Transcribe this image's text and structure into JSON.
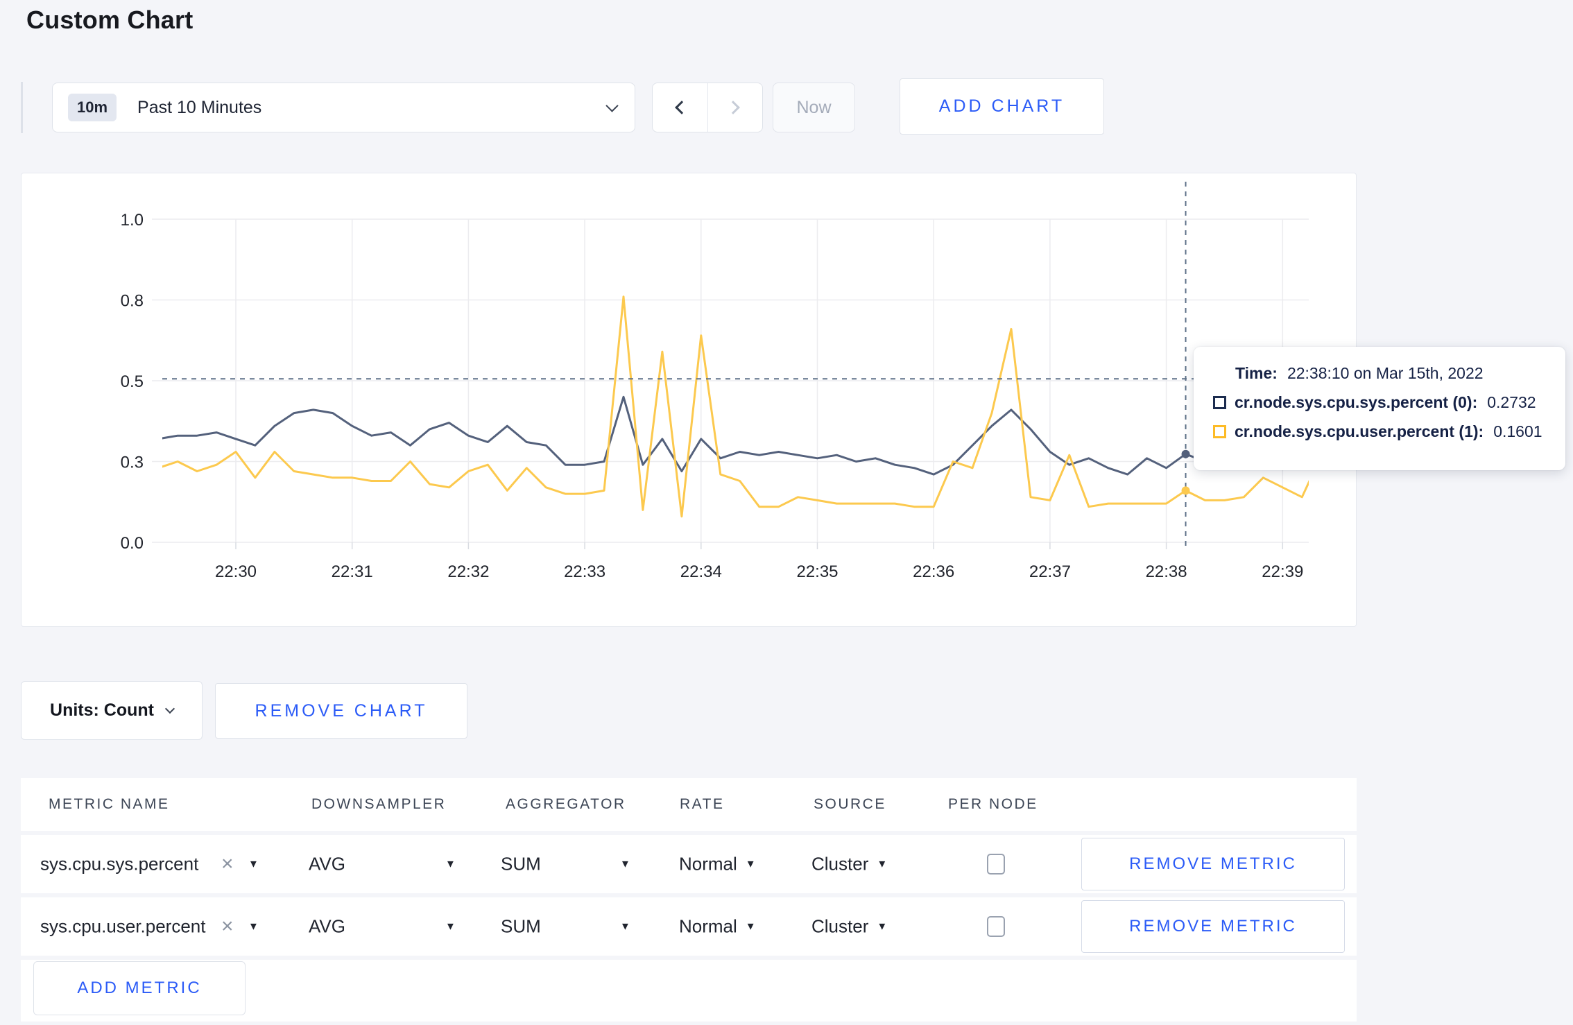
{
  "page": {
    "title": "Custom Chart"
  },
  "toolbar": {
    "time_badge": "10m",
    "time_label": "Past 10 Minutes",
    "now_label": "Now",
    "add_chart_label": "ADD CHART"
  },
  "icons": {
    "close": "×",
    "caret": "▼"
  },
  "accent_color": "#2b5bf7",
  "chart_data": {
    "type": "line",
    "title": "",
    "xlabel": "",
    "ylabel": "",
    "ylim": [
      0,
      1
    ],
    "grid": true,
    "y_tick_values": [
      0,
      0.25,
      0.5,
      0.75,
      1.0
    ],
    "y_tick_labels": [
      "0.0",
      "0.3",
      "0.5",
      "0.8",
      "1.0"
    ],
    "x_tick_labels": [
      "22:30",
      "22:31",
      "22:32",
      "22:33",
      "22:34",
      "22:35",
      "22:36",
      "22:37",
      "22:38",
      "22:39"
    ],
    "start_offset_seconds": -40,
    "point_interval_seconds": 10,
    "series": [
      {
        "name": "cr.node.sys.cpu.sys.percent",
        "color": "#54617c",
        "values": [
          0.32,
          0.33,
          0.33,
          0.34,
          0.32,
          0.3,
          0.36,
          0.4,
          0.41,
          0.4,
          0.36,
          0.33,
          0.34,
          0.3,
          0.35,
          0.37,
          0.33,
          0.31,
          0.36,
          0.31,
          0.3,
          0.24,
          0.24,
          0.25,
          0.45,
          0.24,
          0.32,
          0.22,
          0.32,
          0.26,
          0.28,
          0.27,
          0.28,
          0.27,
          0.26,
          0.27,
          0.25,
          0.26,
          0.24,
          0.23,
          0.21,
          0.24,
          0.3,
          0.36,
          0.41,
          0.35,
          0.28,
          0.24,
          0.26,
          0.23,
          0.21,
          0.26,
          0.23,
          0.2732,
          0.25,
          0.26,
          0.27,
          0.28,
          0.3,
          0.3,
          0.31
        ]
      },
      {
        "name": "cr.node.sys.cpu.user.percent",
        "color": "#fcc94e",
        "values": [
          0.23,
          0.25,
          0.22,
          0.24,
          0.28,
          0.2,
          0.28,
          0.22,
          0.21,
          0.2,
          0.2,
          0.19,
          0.19,
          0.25,
          0.18,
          0.17,
          0.22,
          0.24,
          0.16,
          0.23,
          0.17,
          0.15,
          0.15,
          0.16,
          0.76,
          0.1,
          0.59,
          0.08,
          0.64,
          0.21,
          0.19,
          0.11,
          0.11,
          0.14,
          0.13,
          0.12,
          0.12,
          0.12,
          0.12,
          0.11,
          0.11,
          0.25,
          0.23,
          0.4,
          0.66,
          0.14,
          0.13,
          0.27,
          0.11,
          0.12,
          0.12,
          0.12,
          0.12,
          0.1601,
          0.13,
          0.13,
          0.14,
          0.2,
          0.17,
          0.14,
          0.27
        ]
      }
    ],
    "crosshair": {
      "time_offset_seconds": 490,
      "hline_value": 0.506,
      "point_values": [
        0.2732,
        0.1601
      ]
    }
  },
  "tooltip": {
    "time_label": "Time:",
    "time_value": "22:38:10 on Mar 15th, 2022",
    "series": [
      {
        "label": "cr.node.sys.cpu.sys.percent (0):",
        "value": "0.2732",
        "color": "#1c2c4f"
      },
      {
        "label": "cr.node.sys.cpu.user.percent (1):",
        "value": "0.1601",
        "color": "#fdbb26"
      }
    ]
  },
  "chart_controls": {
    "units_label": "Units: Count",
    "remove_chart_label": "REMOVE CHART"
  },
  "metrics_table": {
    "headers": [
      "METRIC NAME",
      "DOWNSAMPLER",
      "AGGREGATOR",
      "RATE",
      "SOURCE",
      "PER NODE"
    ],
    "rows": [
      {
        "metric": "sys.cpu.sys.percent",
        "downsampler": "AVG",
        "aggregator": "SUM",
        "rate": "Normal",
        "source": "Cluster",
        "per_node_checked": false,
        "remove_label": "REMOVE METRIC"
      },
      {
        "metric": "sys.cpu.user.percent",
        "downsampler": "AVG",
        "aggregator": "SUM",
        "rate": "Normal",
        "source": "Cluster",
        "per_node_checked": false,
        "remove_label": "REMOVE METRIC"
      }
    ],
    "add_metric_label": "ADD METRIC"
  }
}
